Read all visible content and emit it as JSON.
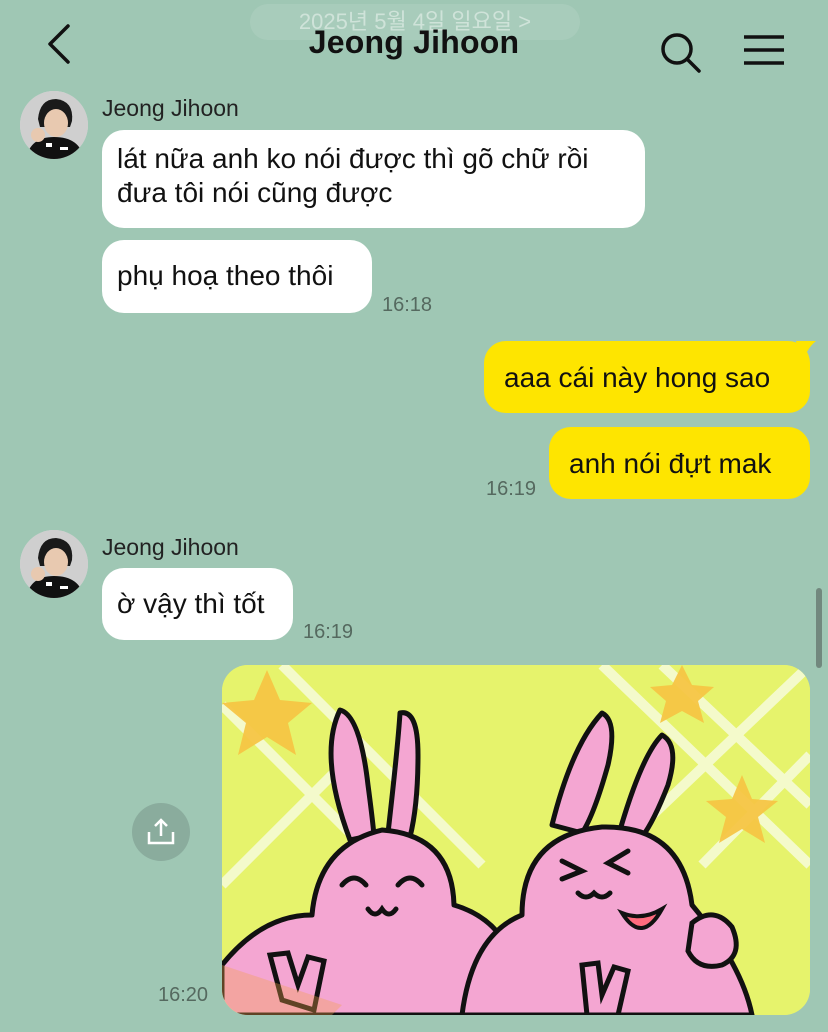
{
  "header": {
    "date_pill": "2025년 5월 4일 일요일 >",
    "title": "Jeong Jihoon"
  },
  "messages": {
    "group1": {
      "sender": "Jeong Jihoon",
      "bubble1_line1": "lát nữa anh ko nói được thì gõ chữ rồi",
      "bubble1_line2": "đưa tôi nói cũng được",
      "bubble2": "phụ hoạ theo thôi",
      "time": "16:18"
    },
    "sent1": {
      "bubble1": "aaa cái này hong sao",
      "bubble2": "anh nói đựt mak",
      "time": "16:19"
    },
    "group2": {
      "sender": "Jeong Jihoon",
      "bubble": "ờ vậy thì tốt",
      "time": "16:19"
    },
    "sent2": {
      "time": "16:20"
    }
  },
  "colors": {
    "background": "#9fc7b4",
    "incoming_bubble": "#ffffff",
    "outgoing_bubble": "#fee500",
    "sticker_bg": "#e6f36c",
    "bunny": "#f4a6d2"
  },
  "icons": [
    "back-arrow-icon",
    "search-icon",
    "menu-icon",
    "calendar-icon",
    "share-icon"
  ]
}
